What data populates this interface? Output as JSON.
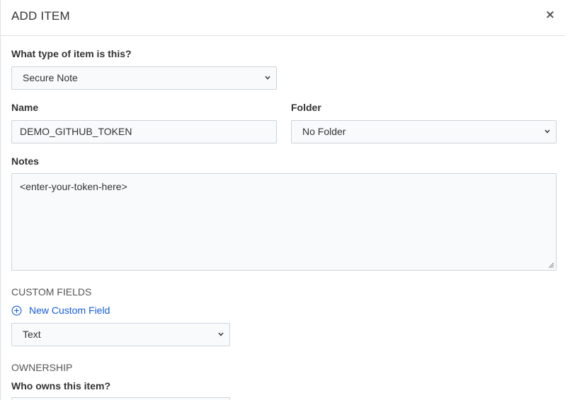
{
  "modal": {
    "title": "ADD ITEM",
    "close_label": "×"
  },
  "type_field": {
    "label": "What type of item is this?",
    "value": "Secure Note"
  },
  "name_field": {
    "label": "Name",
    "value": "DEMO_GITHUB_TOKEN"
  },
  "folder_field": {
    "label": "Folder",
    "value": "No Folder"
  },
  "notes_field": {
    "label": "Notes",
    "value": "<enter-your-token-here>"
  },
  "custom_fields": {
    "heading": "CUSTOM FIELDS",
    "add_label": "New Custom Field",
    "type_value": "Text"
  },
  "ownership": {
    "heading": "OWNERSHIP",
    "question": "Who owns this item?"
  },
  "colors": {
    "accent": "#175ddc",
    "border": "#ced4da"
  }
}
